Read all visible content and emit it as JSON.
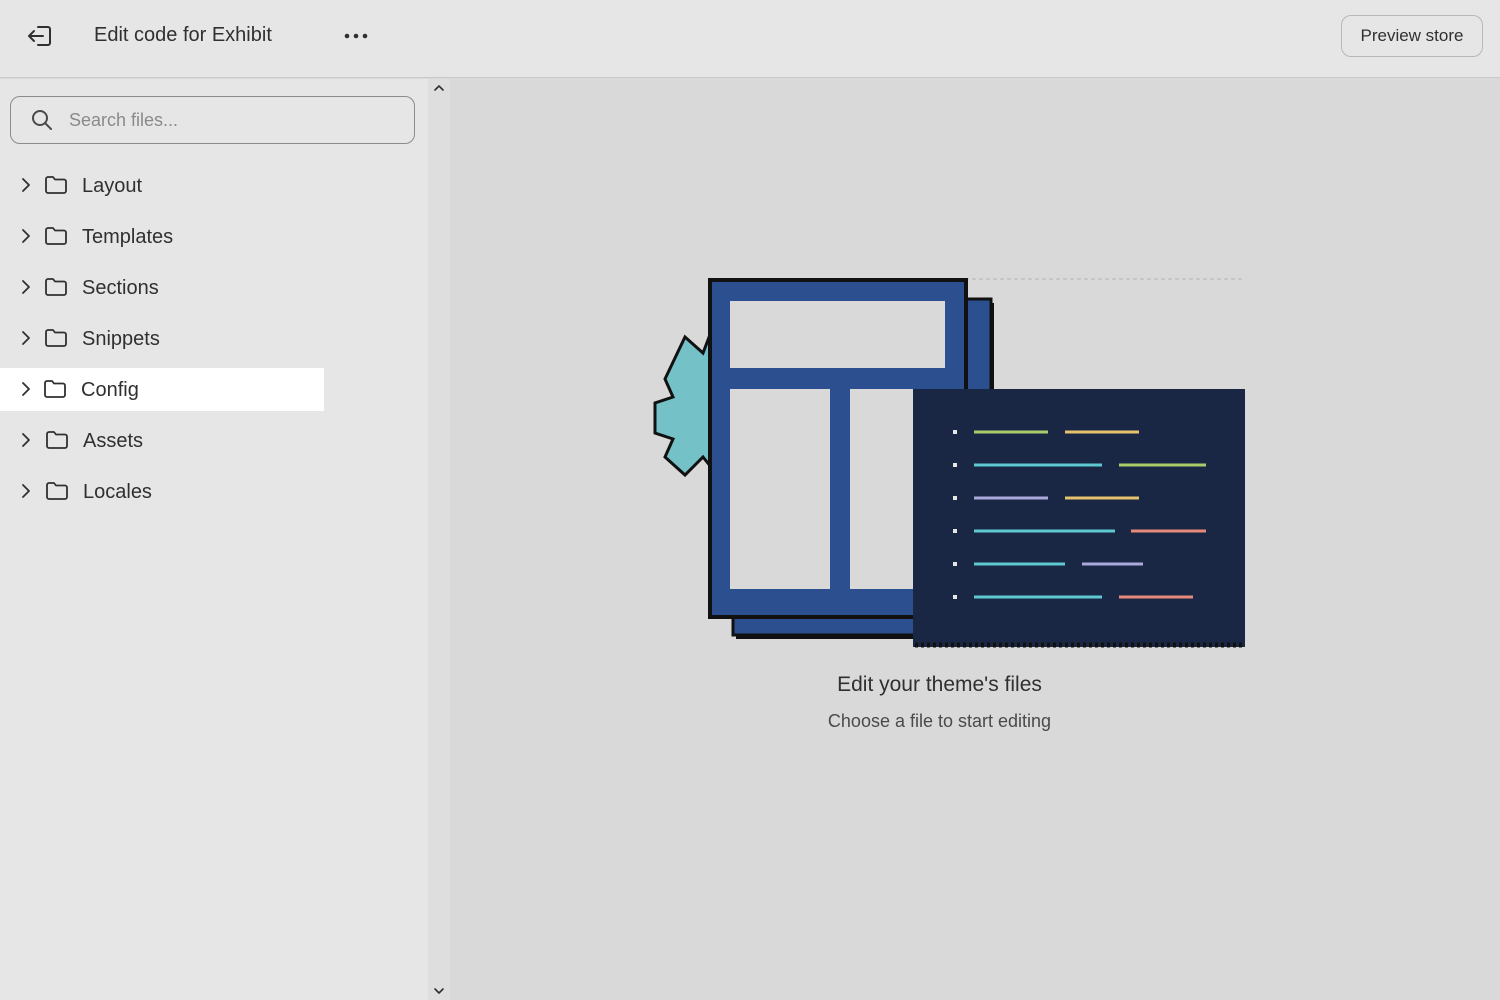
{
  "header": {
    "title": "Edit code for Exhibit",
    "exit_icon": "exit-icon",
    "more_icon": "more-horizontal-icon",
    "preview_label": "Preview store"
  },
  "sidebar": {
    "search": {
      "placeholder": "Search files...",
      "value": ""
    },
    "folders": [
      {
        "label": "Layout",
        "selected": false
      },
      {
        "label": "Templates",
        "selected": false
      },
      {
        "label": "Sections",
        "selected": false
      },
      {
        "label": "Snippets",
        "selected": false
      },
      {
        "label": "Config",
        "selected": true
      },
      {
        "label": "Assets",
        "selected": false
      },
      {
        "label": "Locales",
        "selected": false
      }
    ]
  },
  "main": {
    "empty_title": "Edit your theme's files",
    "empty_subtitle": "Choose a file to start editing"
  },
  "colors": {
    "topbar": "#e6e6e6",
    "sidebar": "#e6e6e6",
    "main": "#d9d9d9",
    "selected_row": "#ffffff",
    "illustration_blue": "#2b4f8f",
    "illustration_navy": "#1a2744",
    "illustration_teal": "#74c2c8"
  }
}
